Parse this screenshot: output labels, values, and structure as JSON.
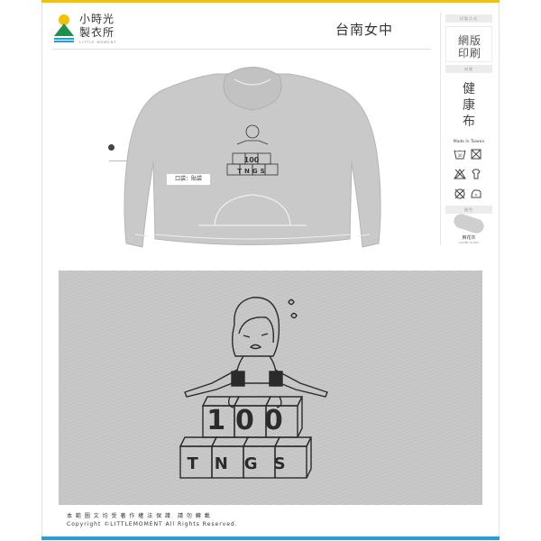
{
  "brand": {
    "name": "小時光\n製衣所",
    "subtitle": "LITTLE MOMENT",
    "colors": {
      "sun": "#f3c200",
      "mountain": "#1f8f4a",
      "water": "#1da1e2"
    }
  },
  "header": {
    "title": "台南女中"
  },
  "spec": {
    "print_method_label": "印製方式",
    "print_method": "網版\n印刷",
    "material_label": "材質",
    "material": "健\n康\n布",
    "made_in": "Made In Taiwan",
    "care_icons": [
      "wash-30-icon",
      "no-bleach-icon",
      "no-tumble-dry-icon",
      "hang-dry-icon",
      "no-dry-clean-icon",
      "iron-low-icon"
    ],
    "color_label": "顏色",
    "color_name": "麻花灰",
    "color_code": "CO.MB YG.500",
    "swatch_color": "#cfcfcf"
  },
  "product": {
    "garment_color": "#c9c9c9",
    "pocket_label": "口袋：貼袋",
    "artwork": {
      "top_text": "100",
      "bottom_text": "TNGS"
    }
  },
  "detail": {
    "artwork": {
      "top_text": "100",
      "bottom_text": "TNGS"
    }
  },
  "footer": {
    "copyright": "本 範 圖 文 均 受 著 作 權 法 保 護　請 勿 轉 載\nCopyright ©LITTLEMOMENT All Rights Reserved."
  }
}
